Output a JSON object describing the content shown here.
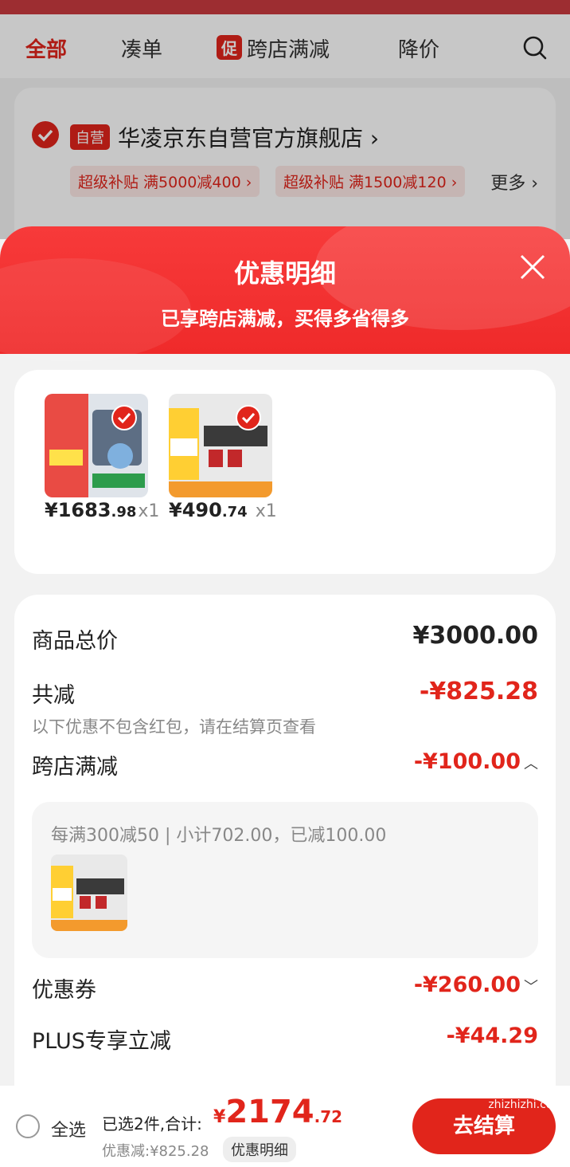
{
  "tabs": {
    "all": "全部",
    "bundle": "凑单",
    "promo_badge": "促",
    "cross_store": "跨店满减",
    "price_drop": "降价"
  },
  "shop": {
    "badge": "自营",
    "name": "华凌京东自营官方旗舰店 ›",
    "coupon1": "超级补贴  满5000减400 ›",
    "coupon2": "超级补贴  满1500减120 ›",
    "more": "更多 ›"
  },
  "sheet": {
    "title": "优惠明细",
    "subtitle": "已享跨店满减，买得多省得多"
  },
  "goods": [
    {
      "sym": "¥",
      "int": "1683",
      "dec": ".98",
      "qty": "x1"
    },
    {
      "sym": "¥",
      "int": "490",
      "dec": ".74",
      "qty": "x1"
    }
  ],
  "detail": {
    "total_label": "商品总价",
    "total_value": "¥3000.00",
    "reduce_label": "共减",
    "reduce_value": "-¥825.28",
    "reduce_note": "以下优惠不包含红包，请在结算页查看",
    "cross_label": "跨店满减",
    "cross_value": "-¥100.00",
    "cross_rule": "每满300减50 | 小计702.00，已减100.00",
    "coupon_label": "优惠券",
    "coupon_value": "-¥260.00",
    "plus_label": "PLUS专享立减",
    "plus_value": "-¥44.29"
  },
  "bottom": {
    "select_all": "全选",
    "selected_text": "已选2件,合计:",
    "total_sym": "¥",
    "total_int": "2174",
    "total_dec": ".72",
    "saved": "优惠减:¥825.28",
    "detail_btn": "优惠明细",
    "checkout": "去结算",
    "watermark": "zhizhizhi.com"
  },
  "colors": {
    "accent": "#e1251b",
    "sheet_header": "#f73a3a"
  }
}
